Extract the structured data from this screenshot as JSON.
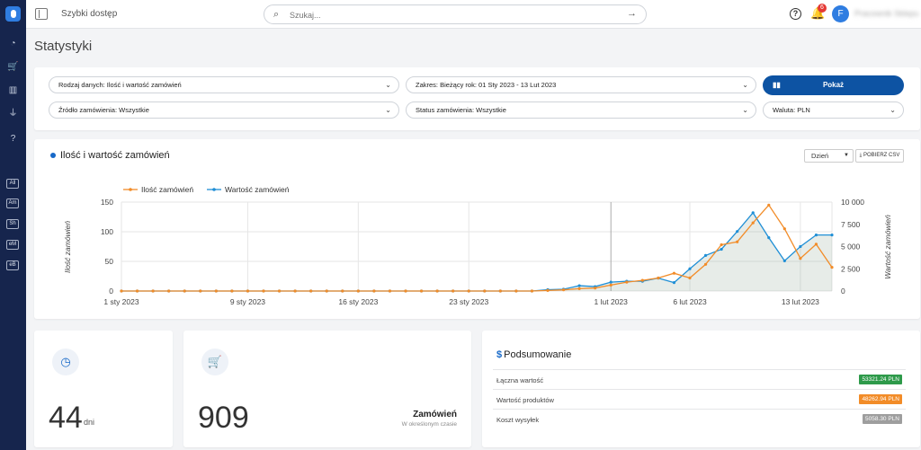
{
  "header": {
    "quick_access": "Szybki dostęp",
    "search_placeholder": "Szukaj...",
    "notif_count": "6",
    "avatar_letter": "F",
    "user_name": "Pracownik Sklepu"
  },
  "sidebar": {
    "tags": [
      "All",
      "Am",
      "Sh",
      "eM",
      "eB"
    ]
  },
  "page": {
    "title": "Statystyki"
  },
  "filters": {
    "data_type": "Rodzaj danych: Ilość i wartość zamówień",
    "range": "Zakres: Bieżący rok: 01 Sty 2023 - 13 Lut 2023",
    "source": "Źródło zamówienia: Wszystkie",
    "status": "Status zamówienia: Wszystkie",
    "currency": "Waluta: PLN",
    "show_label": "Pokaż"
  },
  "chart_card": {
    "title": "Ilość i wartość zamówień",
    "period": "Dzień",
    "csv_label": "POBIERZ CSV"
  },
  "chart_data": {
    "type": "line",
    "legend": [
      "Ilość zamówień",
      "Wartość zamówień"
    ],
    "colors": {
      "orders": "#f28c28",
      "value": "#1f8fd6"
    },
    "ylabel_left": "Ilość zamówień",
    "ylabel_right": "Wartość zamówień",
    "ylim_left": [
      0,
      150
    ],
    "ylim_right": [
      0,
      10000
    ],
    "yticks_left": [
      "150",
      "100",
      "50",
      "0"
    ],
    "yticks_right": [
      "10 000",
      "7 500",
      "5 000",
      "2 500",
      "0"
    ],
    "xticks": [
      "1 sty 2023",
      "9 sty 2023",
      "16 sty 2023",
      "23 sty 2023",
      "1 lut 2023",
      "6 lut 2023",
      "13 lut 2023"
    ],
    "orders": [
      0,
      0,
      0,
      0,
      0,
      0,
      0,
      0,
      0,
      0,
      0,
      0,
      0,
      0,
      0,
      0,
      0,
      0,
      0,
      0,
      0,
      0,
      0,
      0,
      0,
      0,
      0,
      1,
      2,
      4,
      5,
      10,
      15,
      18,
      22,
      30,
      22,
      45,
      78,
      83,
      115,
      145,
      105,
      55,
      79,
      40
    ],
    "value": [
      0,
      0,
      0,
      0,
      0,
      0,
      0,
      0,
      0,
      0,
      0,
      0,
      0,
      0,
      0,
      0,
      0,
      0,
      0,
      0,
      0,
      0,
      0,
      0,
      0,
      0,
      0,
      150,
      200,
      600,
      500,
      1000,
      1100,
      1100,
      1450,
      950,
      2500,
      4000,
      4700,
      6700,
      8800,
      6000,
      3400,
      5000,
      6300,
      6300
    ]
  },
  "stats": {
    "days_value": "44",
    "days_unit": "dni",
    "orders_value": "909",
    "orders_label": "Zamówień",
    "orders_sub": "W określonym czasie"
  },
  "summary": {
    "title": "Podsumowanie",
    "rows": [
      {
        "label": "Łączna wartość",
        "value": "53321.24 PLN",
        "color": "#2e9a4a"
      },
      {
        "label": "Wartość produktów",
        "value": "48262.94 PLN",
        "color": "#f28c28"
      },
      {
        "label": "Koszt wysyłek",
        "value": "5058.30 PLN",
        "color": "#9e9e9e"
      }
    ]
  }
}
